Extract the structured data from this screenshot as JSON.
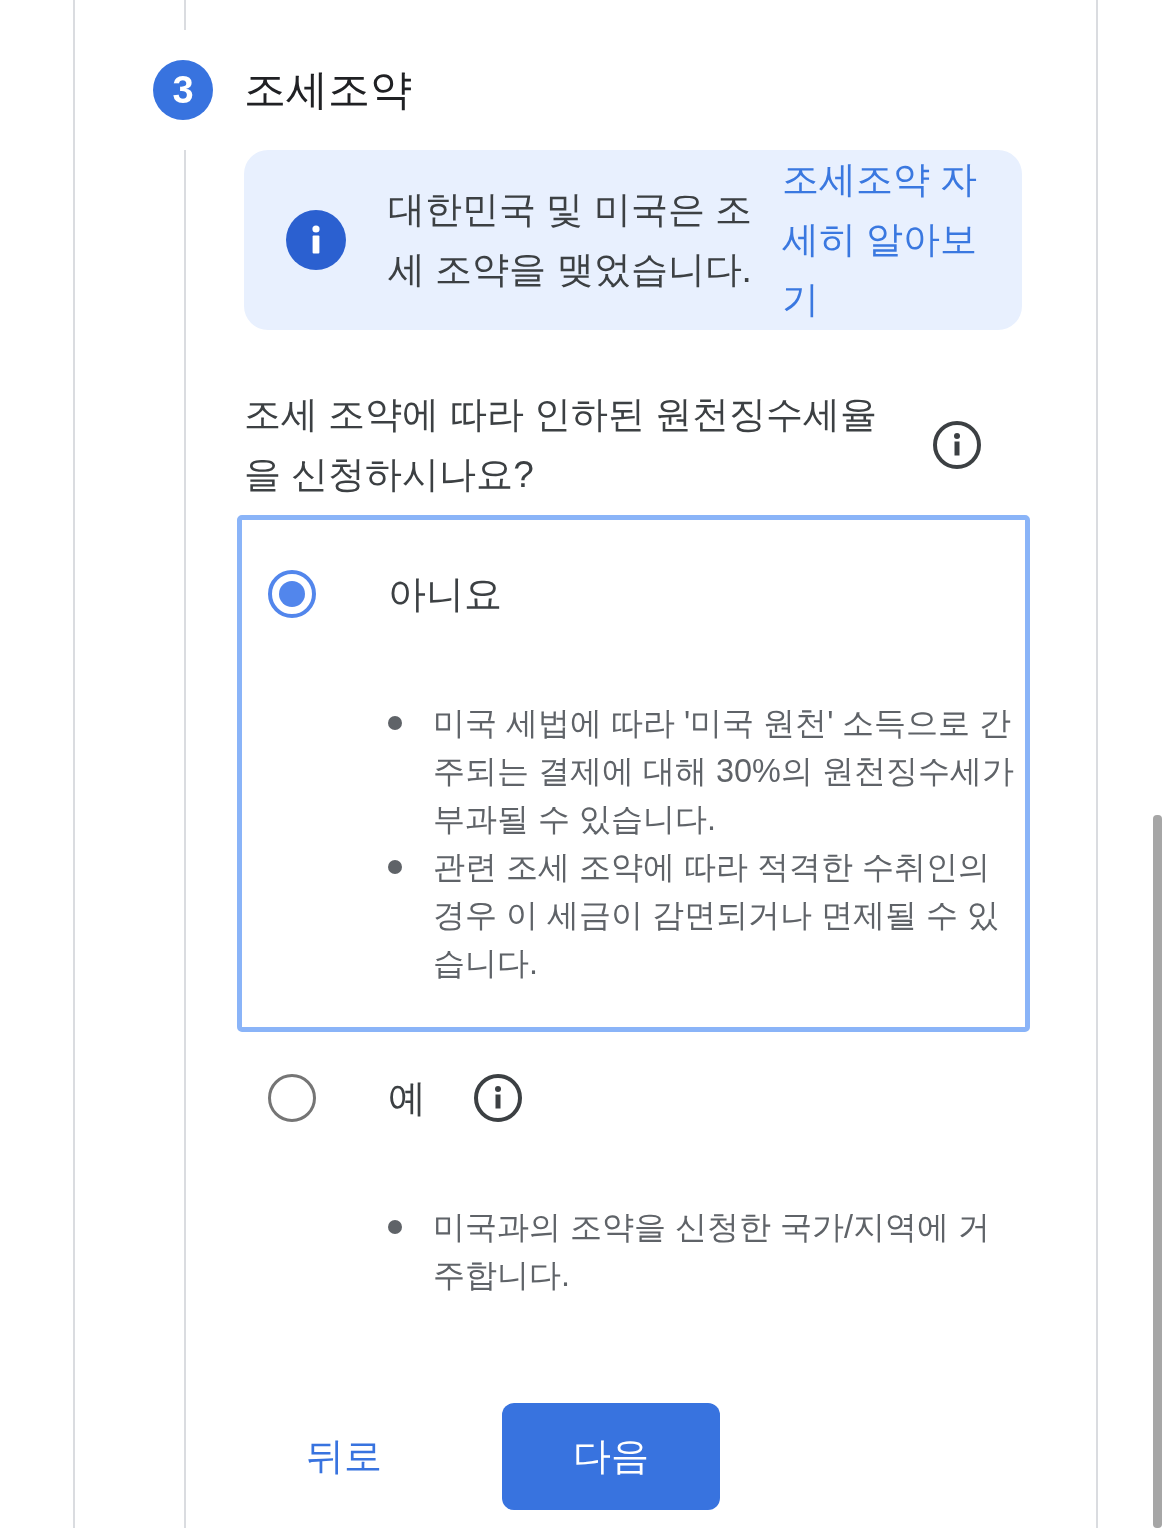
{
  "step": {
    "number": "3",
    "title": "조세조약"
  },
  "notice": {
    "text": "대한민국 및 미국은 조세 조약을 맺었습니다.",
    "link": "조세조약 자세히 알아보기"
  },
  "question": {
    "text": "조세 조약에 따라 인하된 원천징수세율을 신청하시나요?"
  },
  "options": [
    {
      "label": "아니요",
      "selected": true,
      "info": false,
      "notes": [
        "미국 세법에 따라 '미국 원천' 소득으로 간주되는 결제에 대해 30%의 원천징수세가 부과될 수 있습니다.",
        "관련 조세 조약에 따라 적격한 수취인의 경우 이 세금이 감면되거나 면제될 수 있습니다."
      ]
    },
    {
      "label": "예",
      "selected": false,
      "info": true,
      "notes": [
        "미국과의 조약을 신청한 국가/지역에 거주합니다."
      ]
    }
  ],
  "buttons": [
    {
      "label": "뒤로",
      "kind": "text"
    },
    {
      "label": "다음",
      "kind": "primary"
    }
  ]
}
